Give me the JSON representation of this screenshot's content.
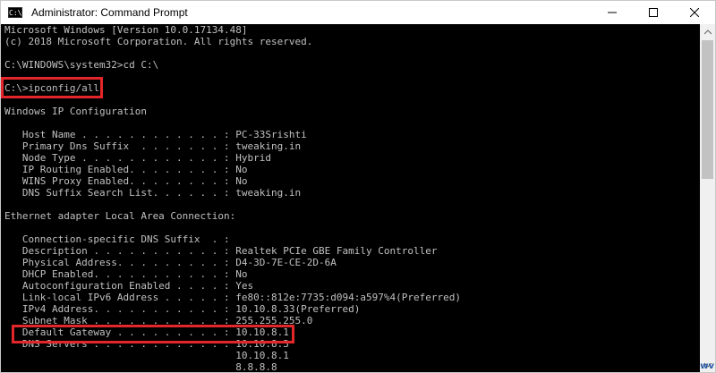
{
  "window": {
    "title": "Administrator: Command Prompt",
    "icon_text": "C:\\",
    "controls": [
      "minimize-icon",
      "maximize-icon",
      "close-icon"
    ]
  },
  "console": {
    "lines": [
      "Microsoft Windows [Version 10.0.17134.48]",
      "(c) 2018 Microsoft Corporation. All rights reserved.",
      "",
      "C:\\WINDOWS\\system32>cd C:\\",
      "",
      "C:\\>ipconfig/all",
      "",
      "Windows IP Configuration",
      "",
      "   Host Name . . . . . . . . . . . . : PC-33Srishti",
      "   Primary Dns Suffix  . . . . . . . : tweaking.in",
      "   Node Type . . . . . . . . . . . . : Hybrid",
      "   IP Routing Enabled. . . . . . . . : No",
      "   WINS Proxy Enabled. . . . . . . . : No",
      "   DNS Suffix Search List. . . . . . : tweaking.in",
      "",
      "Ethernet adapter Local Area Connection:",
      "",
      "   Connection-specific DNS Suffix  . :",
      "   Description . . . . . . . . . . . : Realtek PCIe GBE Family Controller",
      "   Physical Address. . . . . . . . . : D4-3D-7E-CE-2D-6A",
      "   DHCP Enabled. . . . . . . . . . . : No",
      "   Autoconfiguration Enabled . . . . : Yes",
      "   Link-local IPv6 Address . . . . . : fe80::812e:7735:d094:a597%4(Preferred)",
      "   IPv4 Address. . . . . . . . . . . : 10.10.8.33(Preferred)",
      "   Subnet Mask . . . . . . . . . . . : 255.255.255.0",
      "   Default Gateway . . . . . . . . . : 10.10.8.1",
      "   DNS Servers . . . . . . . . . . . : 10.10.8.3",
      "                                       10.10.8.1",
      "                                       8.8.8.8"
    ]
  },
  "colors": {
    "console_bg": "#000000",
    "console_text": "#c0c0c0",
    "highlight": "#e3262a"
  },
  "watermark": "wv"
}
